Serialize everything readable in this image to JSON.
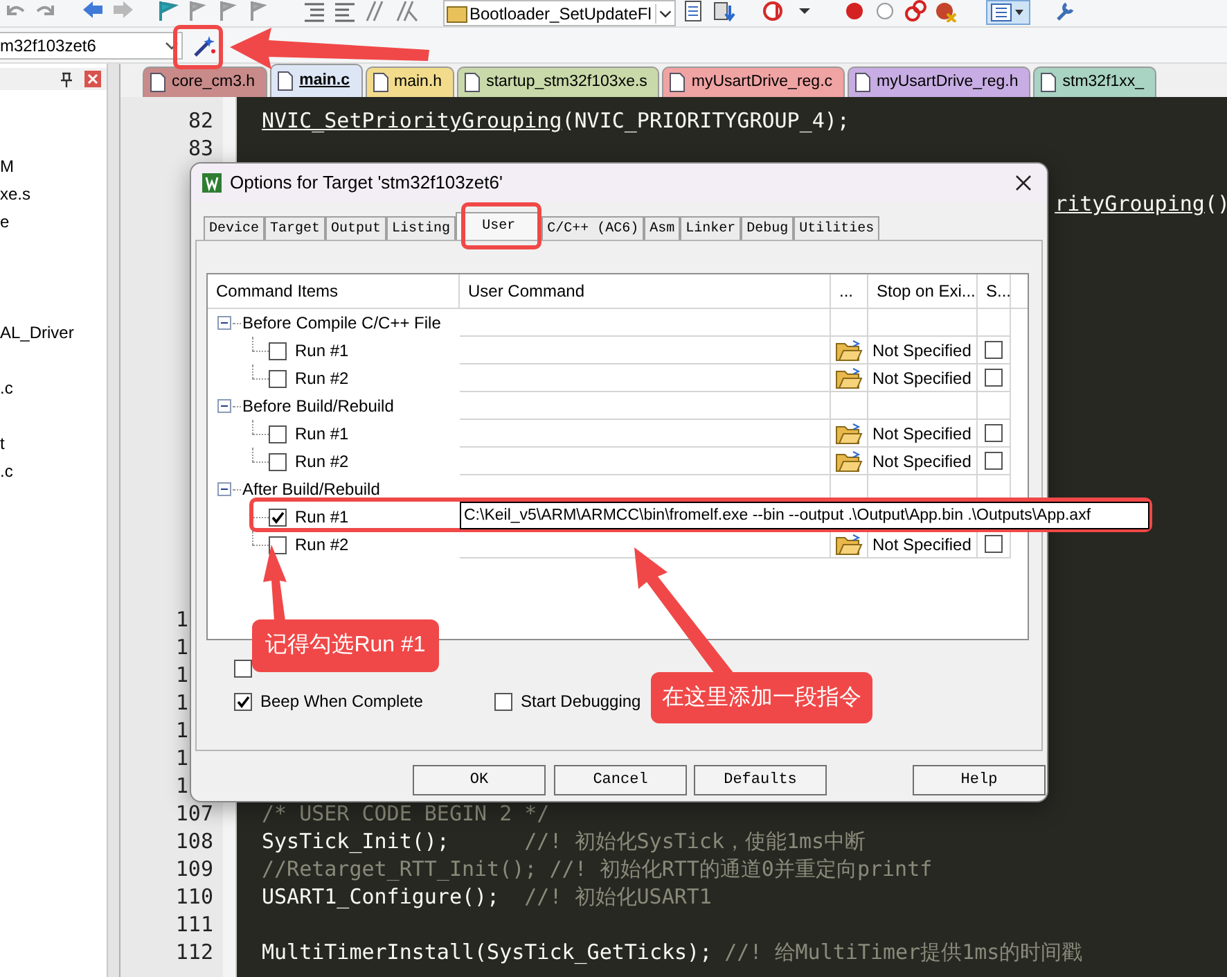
{
  "toolbar": {
    "project_combo": "Bootloader_SetUpdateFl"
  },
  "target_bar": {
    "target": "m32f103zet6"
  },
  "project_panel": {
    "items": [
      "M",
      "xe.s",
      "e",
      "AL_Driver",
      ".c",
      "t",
      ".c"
    ]
  },
  "file_tabs": [
    {
      "label": "core_cm3.h",
      "color": "#c98a8a",
      "selected": false
    },
    {
      "label": "main.c",
      "color": "#dde6f4",
      "selected": true
    },
    {
      "label": "main.h",
      "color": "#f2dc8c",
      "selected": false
    },
    {
      "label": "startup_stm32f103xe.s",
      "color": "#c9d9a9",
      "selected": false
    },
    {
      "label": "myUsartDrive_reg.c",
      "color": "#f0a3a3",
      "selected": false
    },
    {
      "label": "myUsartDrive_reg.h",
      "color": "#c7ade3",
      "selected": false
    },
    {
      "label": "stm32f1xx_",
      "color": "#a9d3c3",
      "selected": false
    }
  ],
  "editor": {
    "lines": [
      {
        "number": "82",
        "parts": [
          {
            "kind": "call",
            "text": "NVIC_SetPriorityGrouping"
          },
          {
            "kind": "code",
            "text": "(NVIC_PRIORITYGROUP_4);"
          }
        ]
      },
      {
        "number": "83"
      },
      {
        "kind": "partial",
        "parts": [
          {
            "kind": "call",
            "text": "rityGrouping"
          },
          {
            "kind": "code",
            "text": "()"
          }
        ]
      },
      {
        "kind": "stub",
        "number": "1"
      },
      {
        "kind": "stub",
        "number": "1"
      },
      {
        "kind": "stub",
        "number": "1"
      },
      {
        "kind": "stub",
        "number": "1"
      },
      {
        "kind": "stub",
        "number": "1"
      },
      {
        "kind": "stub",
        "number": "1"
      },
      {
        "kind": "stub",
        "number": "1"
      },
      {
        "number": "107",
        "parts": [
          {
            "kind": "comment",
            "text": "/* USER CODE BEGIN 2 */"
          }
        ]
      },
      {
        "number": "108",
        "parts": [
          {
            "kind": "code",
            "text": "SysTick_Init();"
          },
          {
            "kind": "comment",
            "text": "      //! 初始化SysTick，使能1ms中断"
          }
        ]
      },
      {
        "number": "109",
        "parts": [
          {
            "kind": "comment",
            "text": "//Retarget_RTT_Init(); //! 初始化RTT的通道0并重定向printf"
          }
        ]
      },
      {
        "number": "110",
        "parts": [
          {
            "kind": "code",
            "text": "USART1_Configure();"
          },
          {
            "kind": "comment",
            "text": "  //! 初始化USART1"
          }
        ]
      },
      {
        "number": "111"
      },
      {
        "number": "112",
        "parts": [
          {
            "kind": "code",
            "text": "MultiTimerInstall(SysTick_GetTicks);"
          },
          {
            "kind": "comment",
            "text": " //! 给MultiTimer提供1ms的时间戳"
          }
        ]
      }
    ]
  },
  "dialog": {
    "title": "Options for Target 'stm32f103zet6'",
    "tabs": [
      {
        "label": "Device",
        "selected": false
      },
      {
        "label": "Target",
        "selected": false
      },
      {
        "label": "Output",
        "selected": false
      },
      {
        "label": "Listing",
        "selected": false
      },
      {
        "label": "User",
        "selected": true
      },
      {
        "label": "C/C++ (AC6)",
        "selected": false
      },
      {
        "label": "Asm",
        "selected": false
      },
      {
        "label": "Linker",
        "selected": false
      },
      {
        "label": "Debug",
        "selected": false
      },
      {
        "label": "Utilities",
        "selected": false
      }
    ],
    "table": {
      "columns": [
        "Command Items",
        "User Command",
        "...",
        "Stop on Exi...",
        "S..."
      ],
      "groups": [
        {
          "label": "Before Compile C/C++ File",
          "items": [
            {
              "label": "Run #1",
              "checked": false,
              "stop": "Not Specified",
              "s_checked": false
            },
            {
              "label": "Run #2",
              "checked": false,
              "stop": "Not Specified",
              "s_checked": false
            }
          ]
        },
        {
          "label": "Before Build/Rebuild",
          "items": [
            {
              "label": "Run #1",
              "checked": false,
              "stop": "Not Specified",
              "s_checked": false
            },
            {
              "label": "Run #2",
              "checked": false,
              "stop": "Not Specified",
              "s_checked": false
            }
          ]
        },
        {
          "label": "After Build/Rebuild",
          "items": [
            {
              "label": "Run #1",
              "checked": true,
              "command": "C:\\Keil_v5\\ARM\\ARMCC\\bin\\fromelf.exe --bin --output .\\Output\\App.bin .\\Outputs\\App.axf"
            },
            {
              "label": "Run #2",
              "checked": false,
              "stop": "Not Specified",
              "s_checked": false
            }
          ]
        }
      ]
    },
    "options": [
      {
        "checked": false
      },
      {
        "label": "Beep When Complete",
        "checked": true
      },
      {
        "label": "Start Debugging",
        "checked": false
      }
    ],
    "buttons": [
      "OK",
      "Cancel",
      "Defaults",
      "Help"
    ]
  },
  "annotations": [
    {
      "text": "记得勾选Run #1"
    },
    {
      "text": "在这里添加一段指令"
    }
  ]
}
